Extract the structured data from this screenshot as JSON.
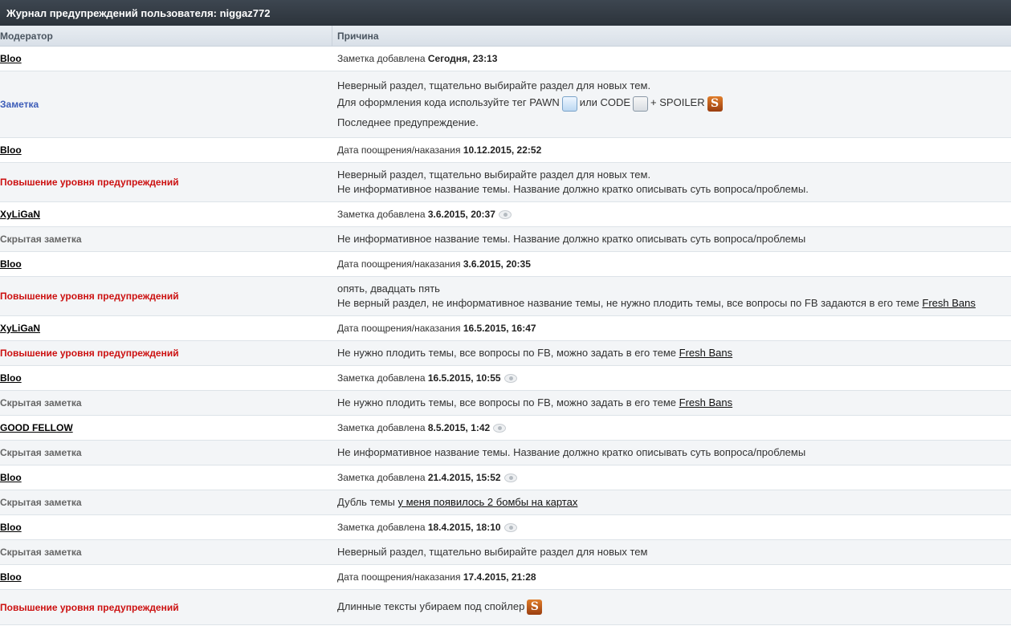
{
  "title": "Журнал предупреждений пользователя: niggaz772",
  "columns": {
    "moderator": "Модератор",
    "reason": "Причина"
  },
  "rows": [
    {
      "mod": "Bloo",
      "kind": "mod",
      "r1pre": "Заметка добавлена ",
      "r1b": "Сегодня, 23:13"
    },
    {
      "mod": "Заметка",
      "kind": "note",
      "l1": "Неверный раздел, тщательно выбирайте раздел для новых тем.",
      "l2a": "Для оформления кода используйте тег PAWN",
      "l2b": "или CODE",
      "l2c": "+ SPOILER",
      "l3": "Последнее предупреждение."
    },
    {
      "mod": "Bloo",
      "kind": "mod",
      "r1pre": "Дата поощрения/наказания ",
      "r1b": "10.12.2015, 22:52"
    },
    {
      "mod": "Повышение уровня предупреждений",
      "kind": "warn",
      "l1": "Неверный раздел, тщательно выбирайте раздел для новых тем.",
      "l2": "Не информативное название темы. Название должно кратко описывать суть вопроса/проблемы."
    },
    {
      "mod": "XyLiGaN",
      "kind": "mod",
      "r1pre": "Заметка добавлена ",
      "r1b": "3.6.2015, 20:37"
    },
    {
      "mod": "Скрытая заметка",
      "kind": "hidden",
      "l1": "Не информативное название темы. Название должно кратко описывать суть вопроса/проблемы"
    },
    {
      "mod": "Bloo",
      "kind": "mod",
      "r1pre": "Дата поощрения/наказания ",
      "r1b": "3.6.2015, 20:35"
    },
    {
      "mod": "Повышение уровня предупреждений",
      "kind": "warn",
      "l1": "опять, двадцать пять",
      "l2": "Не верный раздел, не информативное название темы, не нужно плодить темы, все вопросы по FB задаются в его теме ",
      "link": "Fresh Bans"
    },
    {
      "mod": "XyLiGaN",
      "kind": "mod",
      "r1pre": "Дата поощрения/наказания ",
      "r1b": "16.5.2015, 16:47"
    },
    {
      "mod": "Повышение уровня предупреждений",
      "kind": "warn",
      "l1": "Не нужно плодить темы, все вопросы по FB, можно задать в его теме ",
      "link": "Fresh Bans"
    },
    {
      "mod": "Bloo",
      "kind": "mod",
      "r1pre": "Заметка добавлена ",
      "r1b": "16.5.2015, 10:55"
    },
    {
      "mod": "Скрытая заметка",
      "kind": "hidden",
      "l1": "Не нужно плодить темы, все вопросы по FB, можно задать в его теме ",
      "link": "Fresh Bans"
    },
    {
      "mod": "GOOD FELLOW",
      "kind": "mod",
      "r1pre": "Заметка добавлена ",
      "r1b": "8.5.2015, 1:42"
    },
    {
      "mod": "Скрытая заметка",
      "kind": "hidden",
      "l1": "Не информативное название темы. Название должно кратко описывать суть вопроса/проблемы"
    },
    {
      "mod": "Bloo",
      "kind": "mod",
      "r1pre": "Заметка добавлена ",
      "r1b": "21.4.2015, 15:52"
    },
    {
      "mod": "Скрытая заметка",
      "kind": "hidden",
      "l1": "Дубль темы ",
      "link": "у меня появилось 2 бомбы на картах"
    },
    {
      "mod": "Bloo",
      "kind": "mod",
      "r1pre": "Заметка добавлена ",
      "r1b": "18.4.2015, 18:10"
    },
    {
      "mod": "Скрытая заметка",
      "kind": "hidden",
      "l1": "Неверный раздел, тщательно выбирайте раздел для новых тем"
    },
    {
      "mod": "Bloo",
      "kind": "mod",
      "r1pre": "Дата поощрения/наказания ",
      "r1b": "17.4.2015, 21:28"
    },
    {
      "mod": "Повышение уровня предупреждений",
      "kind": "warn",
      "l1": "Длинные тексты убираем под спойлер"
    }
  ]
}
